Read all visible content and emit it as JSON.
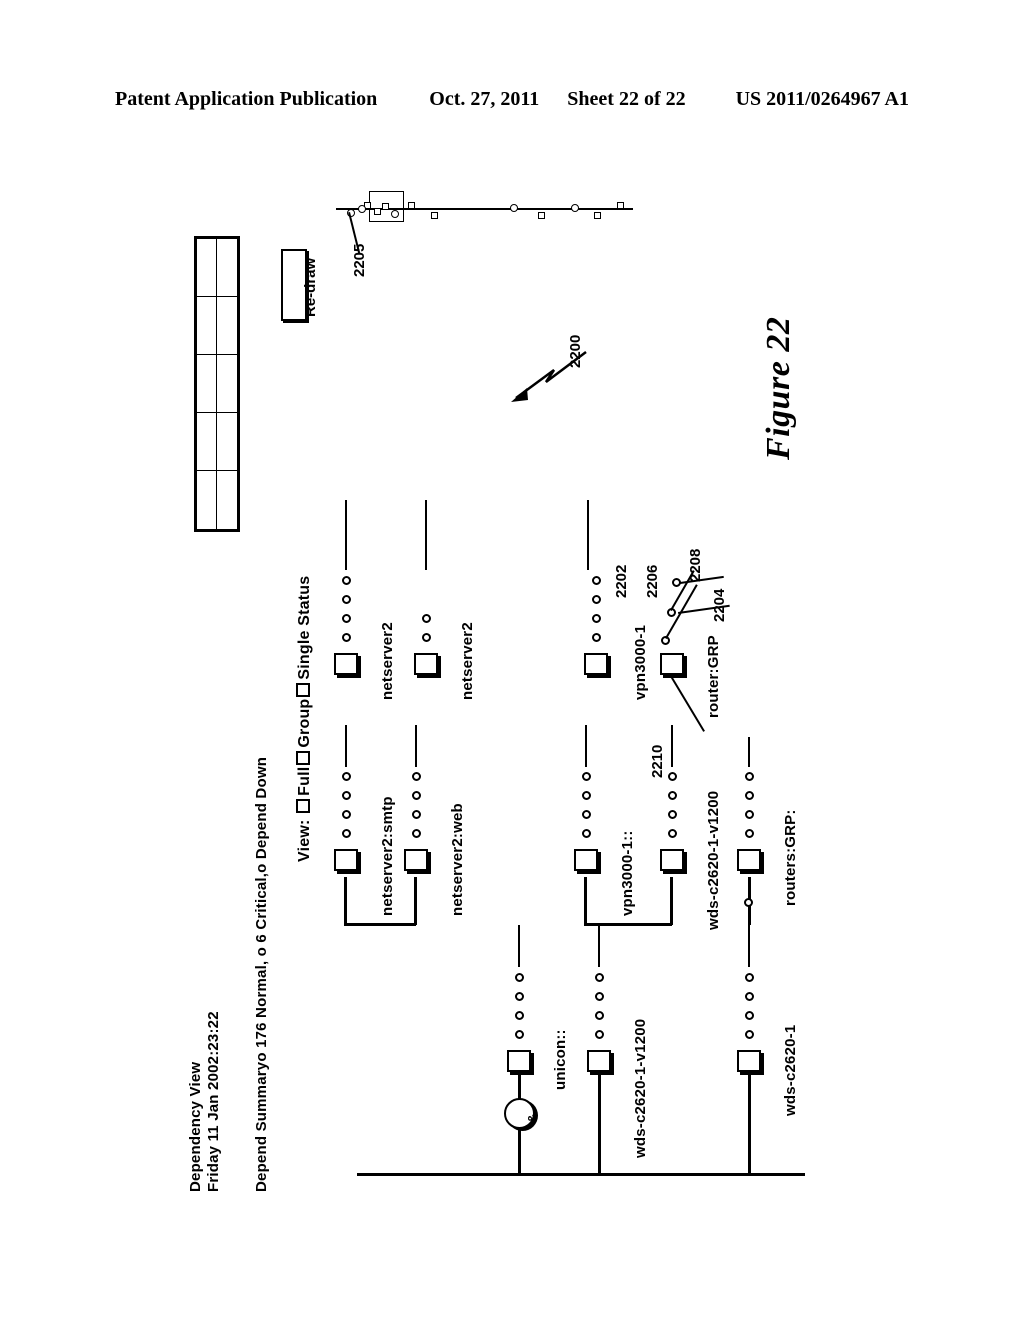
{
  "header": {
    "publication": "Patent Application Publication",
    "date": "Oct. 27, 2011",
    "sheet": "Sheet 22 of 22",
    "number": "US 2011/0264967 A1"
  },
  "figure": {
    "caption": "Figure 22",
    "main_ref": "2200"
  },
  "panel": {
    "title": "Dependency View",
    "timestamp": "Friday 11 Jan 2002:23:22",
    "summary": "Depend Summaryo 176 Normal,  o  6 Critical,o  Depend Down",
    "view_label": "View:",
    "view_options": [
      {
        "label": "Full",
        "checked": false
      },
      {
        "label": "Group",
        "checked": false
      },
      {
        "label": "Single Status",
        "checked": false
      }
    ],
    "redraw_label": "Re-draw",
    "grid_rows": 5,
    "grid_cols": 2
  },
  "overview_strip": {
    "ref": "2205"
  },
  "tree": {
    "nodes": [
      {
        "id": "n1",
        "label": "netserver2"
      },
      {
        "id": "n2",
        "label": "netserver2"
      },
      {
        "id": "n3",
        "label": "netserver2:smtp"
      },
      {
        "id": "n4",
        "label": "netserver2:web"
      },
      {
        "id": "n5",
        "label": "vpn3000-1"
      },
      {
        "id": "n6",
        "label": "router:GRP"
      },
      {
        "id": "n7",
        "label": "vpn3000-1::"
      },
      {
        "id": "n8",
        "label": "wds-c2620-1-v1200"
      },
      {
        "id": "n9",
        "label": "routers:GRP:"
      },
      {
        "id": "n10",
        "label": "unicon::"
      },
      {
        "id": "n11",
        "label": "wds-c2620-1-v1200"
      },
      {
        "id": "n12",
        "label": "wds-c2620-1"
      }
    ],
    "and_gate_symbol": "&",
    "references": [
      {
        "label": "2202"
      },
      {
        "label": "2206"
      },
      {
        "label": "2208"
      },
      {
        "label": "2204"
      },
      {
        "label": "2210"
      }
    ]
  }
}
